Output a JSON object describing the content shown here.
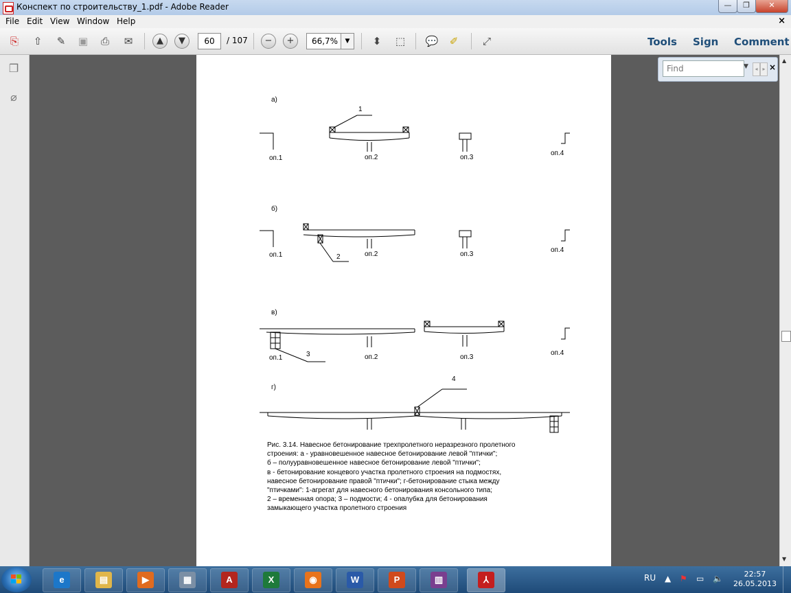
{
  "window": {
    "title": "Конспект по строительству_1.pdf - Adobe Reader",
    "controls": [
      "—",
      "❐",
      "✕"
    ]
  },
  "menu": [
    "File",
    "Edit",
    "View",
    "Window",
    "Help"
  ],
  "toolbar": {
    "page_current": "60",
    "page_total": "/ 107",
    "zoom": "66,7%",
    "right_links": [
      "Tools",
      "Sign",
      "Comment"
    ]
  },
  "find": {
    "placeholder": "Find"
  },
  "document": {
    "panels": [
      {
        "letter": "а)",
        "labels": [
          "оп.1",
          "оп.2",
          "оп.3",
          "оп.4"
        ],
        "callout": "1"
      },
      {
        "letter": "б)",
        "labels": [
          "оп.1",
          "оп.2",
          "оп.3",
          "оп.4"
        ],
        "callout": "2"
      },
      {
        "letter": "в)",
        "labels": [
          "оп.1",
          "оп.2",
          "оп.3",
          "оп.4"
        ],
        "callout": "3"
      },
      {
        "letter": "г)",
        "labels": [],
        "callout": "4"
      }
    ],
    "caption_lines": [
      "Рис. 3.14. Навесное бетонирование трехпролетного неразрезного пролетного",
      "строения: а - уравновешенное навесное бетонирование левой \"птички\";",
      "б – полууравновешенное навесное бетонирование левой \"птички\";",
      "в - бетонирование концевого участка пролетного строения на подмостях,",
      "навесное бетонирование правой \"птички\"; г-бетонирование стыка между",
      "\"птичками\": 1-агрегат для навесного бетонирования консольного типа;",
      "2 – временная опора; 3 – подмости; 4 - опалубка для бетонирования",
      "замыкающего участка пролетного строения"
    ]
  },
  "taskbar": {
    "apps": [
      {
        "name": "ie",
        "glyph": "e",
        "color": "#1c77c9"
      },
      {
        "name": "explorer",
        "glyph": "▤",
        "color": "#e0b64a"
      },
      {
        "name": "media-player",
        "glyph": "▶",
        "color": "#e06b1f"
      },
      {
        "name": "calculator",
        "glyph": "▦",
        "color": "#7b8fa5"
      },
      {
        "name": "autocad",
        "glyph": "A",
        "color": "#b3261e"
      },
      {
        "name": "excel",
        "glyph": "X",
        "color": "#1e7a3a"
      },
      {
        "name": "firefox",
        "glyph": "◉",
        "color": "#e8731b"
      },
      {
        "name": "word",
        "glyph": "W",
        "color": "#2a5aa8"
      },
      {
        "name": "powerpoint",
        "glyph": "P",
        "color": "#d04a1c"
      },
      {
        "name": "winrar",
        "glyph": "▥",
        "color": "#7a3f8f"
      },
      {
        "name": "adobe-reader",
        "glyph": "⅄",
        "color": "#c41e1e"
      }
    ],
    "language": "RU",
    "time": "22:57",
    "date": "26.05.2013"
  }
}
